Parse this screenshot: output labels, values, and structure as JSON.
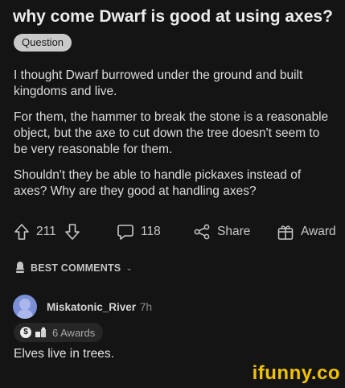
{
  "post": {
    "title": "why come Dwarf is good at using axes?",
    "flair": "Question",
    "paragraphs": [
      "I thought Dwarf burrowed under the ground and built kingdoms and live.",
      "For them, the hammer to break the stone is a reasonable object, but the axe to cut down the tree doesn't seem to be very reasonable for them.",
      "Shouldn't they be able to handle pickaxes instead of axes? Why are they good at handling axes?"
    ]
  },
  "actions": {
    "vote_count": "211",
    "comment_count": "118",
    "share_label": "Share",
    "award_label": "Award"
  },
  "comments_section": {
    "sort_label": "BEST COMMENTS"
  },
  "comment": {
    "username": "Miskatonic_River",
    "age": "7h",
    "awards_label": "6 Awards",
    "text": "Elves live in trees."
  },
  "watermark": {
    "text": "ifunny.co"
  },
  "colors": {
    "background": "#141414",
    "text": "#dcdcdc",
    "watermark": "#f2c200",
    "flair_bg": "#c9c9c9",
    "avatar": "#7c8fd6"
  },
  "icons": [
    "upvote-icon",
    "downvote-icon",
    "comment-icon",
    "share-icon",
    "award-icon",
    "comments-sort-icon",
    "chevron-down-icon",
    "avatar-icon"
  ]
}
